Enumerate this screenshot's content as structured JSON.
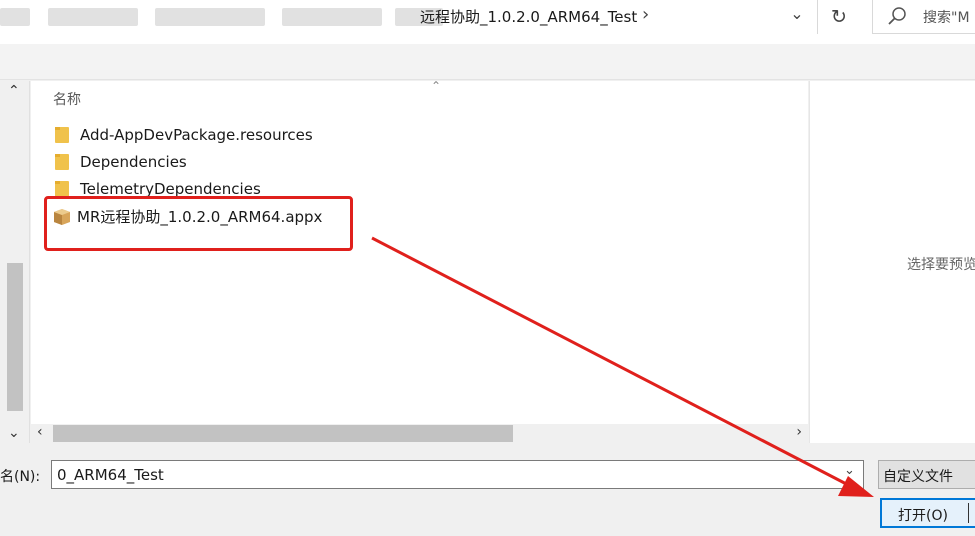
{
  "address_bar": {
    "path_tail": "远程协助_1.0.2.0_ARM64_Test",
    "search_placeholder": "搜索\"M"
  },
  "file_list": {
    "column_header": "名称",
    "items": [
      {
        "name": "Add-AppDevPackage.resources",
        "type": "folder"
      },
      {
        "name": "Dependencies",
        "type": "folder"
      },
      {
        "name": "TelemetryDependencies",
        "type": "folder"
      },
      {
        "name": "MR远程协助_1.0.2.0_ARM64.appx",
        "type": "appx-package"
      }
    ]
  },
  "preview": {
    "placeholder": "选择要预览"
  },
  "bottom": {
    "filename_label": "名(N):",
    "filename_value": "0_ARM64_Test",
    "filetype_value": "自定义文件",
    "open_button": "打开(O)"
  },
  "colors": {
    "annotation": "#e0201c",
    "accent": "#0078d7",
    "folder": "#f0c24b"
  }
}
